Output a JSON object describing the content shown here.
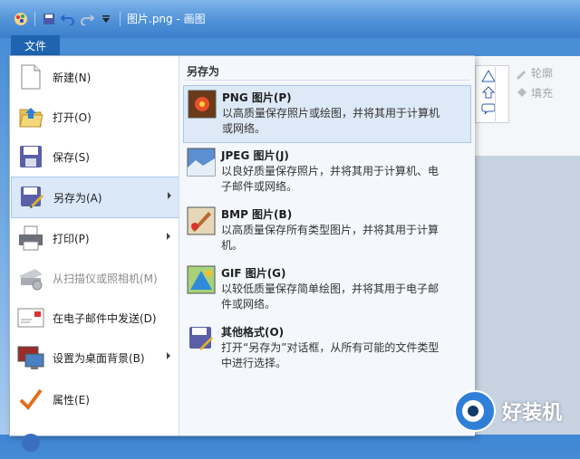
{
  "window": {
    "title": "图片.png - 画图"
  },
  "file_tab": {
    "label": "文件"
  },
  "menu": {
    "items": [
      {
        "label": "新建(N)",
        "icon": "new-file-icon"
      },
      {
        "label": "打开(O)",
        "icon": "open-folder-icon"
      },
      {
        "label": "保存(S)",
        "icon": "save-disk-icon"
      },
      {
        "label": "另存为(A)",
        "icon": "save-as-icon",
        "selected": true,
        "submenu": true
      },
      {
        "label": "打印(P)",
        "icon": "printer-icon",
        "submenu": true
      },
      {
        "label": "从扫描仪或照相机(M)",
        "icon": "scanner-icon",
        "disabled": true
      },
      {
        "label": "在电子邮件中发送(D)",
        "icon": "email-icon"
      },
      {
        "label": "设置为桌面背景(B)",
        "icon": "desktop-background-icon",
        "submenu": true
      },
      {
        "label": "属性(E)",
        "icon": "properties-checkmark-icon"
      }
    ]
  },
  "submenu": {
    "heading": "另存为",
    "items": [
      {
        "title": "PNG 图片(P)",
        "desc": "以高质量保存照片或绘图，并将其用于计算机或网络。",
        "icon": "png-image-icon",
        "selected": true
      },
      {
        "title": "JPEG 图片(J)",
        "desc": "以良好质量保存照片，并将其用于计算机、电子邮件或网络。",
        "icon": "jpeg-image-icon"
      },
      {
        "title": "BMP 图片(B)",
        "desc": "以高质量保存所有类型图片，并将其用于计算机。",
        "icon": "bmp-image-icon"
      },
      {
        "title": "GIF 图片(G)",
        "desc": "以较低质量保存简单绘图，并将其用于电子邮件或网络。",
        "icon": "gif-image-icon"
      },
      {
        "title": "其他格式(O)",
        "desc": "打开“另存为”对话框，从所有可能的文件类型中进行选择。",
        "icon": "other-formats-icon"
      }
    ]
  },
  "ribbon": {
    "outline_label": "轮廓",
    "fill_label": "填充"
  },
  "watermark": {
    "text": "好装机"
  }
}
